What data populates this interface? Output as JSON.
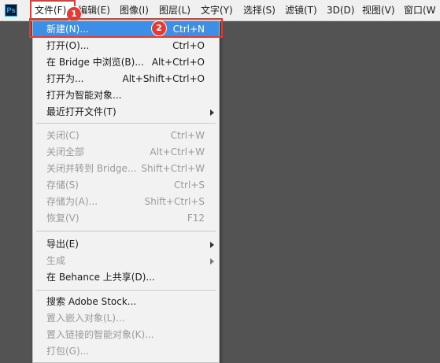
{
  "app": {
    "logo": "Ps"
  },
  "menubar": {
    "items": [
      {
        "label": "文件(F)"
      },
      {
        "label": "编辑(E)"
      },
      {
        "label": "图像(I)"
      },
      {
        "label": "图层(L)"
      },
      {
        "label": "文字(Y)"
      },
      {
        "label": "选择(S)"
      },
      {
        "label": "滤镜(T)"
      },
      {
        "label": "3D(D)"
      },
      {
        "label": "视图(V)"
      },
      {
        "label": "窗口(W"
      }
    ]
  },
  "badges": {
    "first": "1",
    "second": "2"
  },
  "file_menu": {
    "items": [
      {
        "label": "新建(N)...",
        "shortcut": "Ctrl+N"
      },
      {
        "label": "打开(O)...",
        "shortcut": "Ctrl+O"
      },
      {
        "label": "在 Bridge 中浏览(B)...",
        "shortcut": "Alt+Ctrl+O"
      },
      {
        "label": "打开为...",
        "shortcut": "Alt+Shift+Ctrl+O"
      },
      {
        "label": "打开为智能对象...",
        "shortcut": ""
      },
      {
        "label": "最近打开文件(T)",
        "shortcut": ""
      },
      {
        "label": "关闭(C)",
        "shortcut": "Ctrl+W"
      },
      {
        "label": "关闭全部",
        "shortcut": "Alt+Ctrl+W"
      },
      {
        "label": "关闭并转到 Bridge...",
        "shortcut": "Shift+Ctrl+W"
      },
      {
        "label": "存储(S)",
        "shortcut": "Ctrl+S"
      },
      {
        "label": "存储为(A)...",
        "shortcut": "Shift+Ctrl+S"
      },
      {
        "label": "恢复(V)",
        "shortcut": "F12"
      },
      {
        "label": "导出(E)",
        "shortcut": ""
      },
      {
        "label": "生成",
        "shortcut": ""
      },
      {
        "label": "在 Behance 上共享(D)...",
        "shortcut": ""
      },
      {
        "label": "搜索 Adobe Stock...",
        "shortcut": ""
      },
      {
        "label": "置入嵌入对象(L)...",
        "shortcut": ""
      },
      {
        "label": "置入链接的智能对象(K)...",
        "shortcut": ""
      },
      {
        "label": "打包(G)...",
        "shortcut": ""
      }
    ]
  },
  "colors": {
    "highlight": "#3d8ee6",
    "annotation": "#e53935",
    "canvas": "#535353"
  }
}
